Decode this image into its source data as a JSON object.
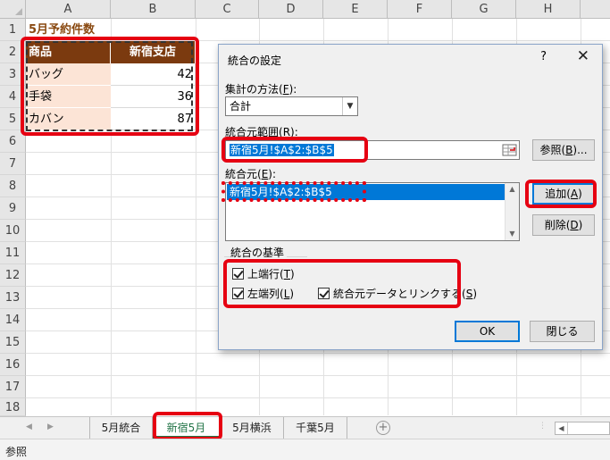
{
  "sheet": {
    "columns": [
      "A",
      "B",
      "C",
      "D",
      "E",
      "F",
      "G",
      "H"
    ],
    "rows": [
      "1",
      "2",
      "3",
      "4",
      "5",
      "6",
      "7",
      "8",
      "9",
      "10",
      "11",
      "12",
      "13",
      "14",
      "15",
      "16",
      "17",
      "18"
    ],
    "title": "5月予約件数",
    "table_header": [
      "商品",
      "新宿支店"
    ],
    "table_rows": [
      {
        "item": "バッグ",
        "value": "42"
      },
      {
        "item": "手袋",
        "value": "36"
      },
      {
        "item": "カバン",
        "value": "87"
      }
    ]
  },
  "dialog": {
    "title": "統合の設定",
    "help": "?",
    "close": "✕",
    "function_label": "集計の方法(",
    "function_key": "F",
    "function_label_end": "):",
    "function_value": "合計",
    "reference_label": "統合元範囲(",
    "reference_key": "R",
    "reference_label_end": "):",
    "reference_value": "新宿5月!$A$2:$B$5",
    "browse_button": "参照(",
    "browse_key": "B",
    "browse_end": ")...",
    "all_references_label": "統合元(",
    "all_references_key": "E",
    "all_references_end": "):",
    "all_references_items": [
      "新宿5月!$A$2:$B$5"
    ],
    "add_button": "追加(",
    "add_key": "A",
    "add_end": ")",
    "delete_button": "削除(",
    "delete_key": "D",
    "delete_end": ")",
    "use_labels_group": "統合の基準",
    "top_row": {
      "label": "上端行(",
      "key": "T",
      "end": ")",
      "checked": true
    },
    "left_column": {
      "label": "左端列(",
      "key": "L",
      "end": ")",
      "checked": true
    },
    "create_links": {
      "label": "統合元データとリンクする(",
      "key": "S",
      "end": ")",
      "checked": true
    },
    "ok_button": "OK",
    "close_button": "閉じる"
  },
  "tabs": [
    {
      "label": "5月統合",
      "active": false
    },
    {
      "label": "新宿5月",
      "active": true
    },
    {
      "label": "5月横浜",
      "active": false
    },
    {
      "label": "千葉5月",
      "active": false
    }
  ],
  "status": {
    "mode": "参照"
  },
  "colors": {
    "highlight": "#e60012",
    "header_fill": "#7b3a0f",
    "label_fill": "#fce4d6",
    "title_text": "#8a4a12",
    "selection": "#0078d7",
    "active_tab": "#217346"
  }
}
